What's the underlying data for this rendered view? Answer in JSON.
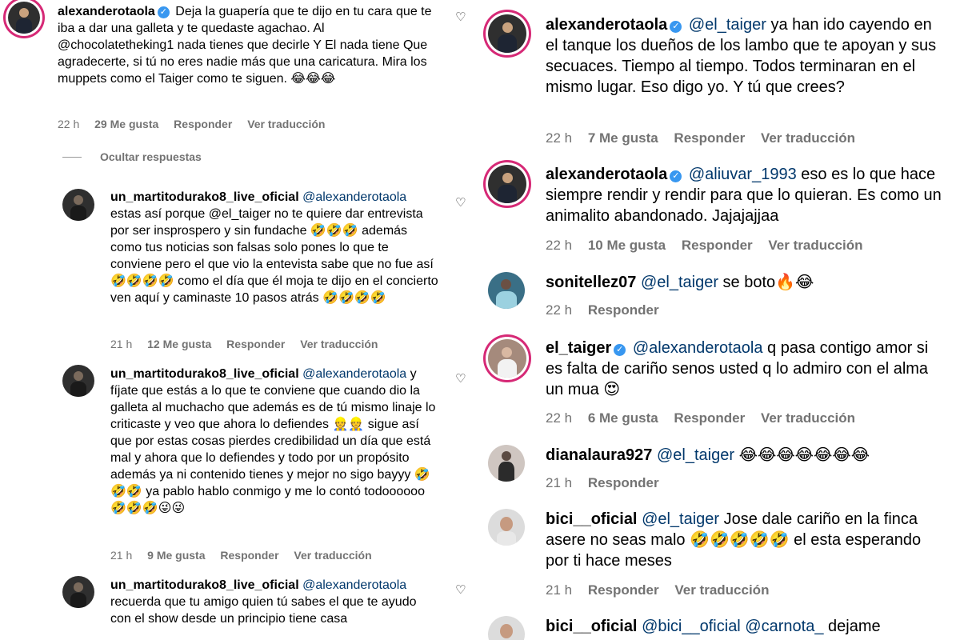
{
  "left": {
    "comments": [
      {
        "username": "alexanderotaola",
        "verified": true,
        "mention": "",
        "text": "Deja la guapería que te dijo en tu cara que te iba a dar una galleta y te quedaste agachao. Al @chocolatetheking1 nada tienes que decirle Y El nada tiene Que agradecerte, si tú no eres nadie más que una caricatura. Mira los muppets como el Taiger como te siguen. 😂😂😂",
        "time": "22 h",
        "likes": "29 Me gusta",
        "reply": "Responder",
        "translate": "Ver traducción"
      },
      {
        "username": "un_martitodurako8_live_oficial",
        "verified": false,
        "mention": "@alexanderotaola",
        "text": "estas así porque @el_taiger no te quiere dar entrevista por ser insprospero y sin fundache 🤣🤣🤣 además como tus noticias son falsas solo pones lo que te conviene pero el que vio la entevista sabe que no fue así 🤣🤣🤣🤣 como el día que él moja te dijo en el concierto ven aquí y caminaste 10 pasos atrás 🤣🤣🤣🤣",
        "time": "21 h",
        "likes": "12 Me gusta",
        "reply": "Responder",
        "translate": "Ver traducción"
      },
      {
        "username": "un_martitodurako8_live_oficial",
        "verified": false,
        "mention": "@alexanderotaola",
        "text": "y fíjate que estás a lo que te conviene que cuando dio la galleta al muchacho que además es de tú mismo linaje lo criticaste y veo que ahora lo defiendes 👷👷 sigue así que por estas cosas pierdes credibilidad un día que está mal y ahora que lo defiendes y todo por un propósito además ya ni contenido tienes y mejor no sigo bayyy 🤣🤣🤣 ya pablo hablo conmigo y me lo contó todoooooo 🤣🤣🤣😜😜",
        "time": "21 h",
        "likes": "9 Me gusta",
        "reply": "Responder",
        "translate": "Ver traducción"
      },
      {
        "username": "un_martitodurako8_live_oficial",
        "verified": false,
        "mention": "@alexanderotaola",
        "text": "recuerda que tu amigo quien tú sabes el que te ayudo con el show desde un principio tiene casa"
      }
    ],
    "hide_replies": "Ocultar respuestas"
  },
  "right": {
    "comments": [
      {
        "username": "alexanderotaola",
        "verified": true,
        "mention": "@el_taiger",
        "text": "ya han ido cayendo en el tanque los dueños de los lambo que te apoyan y sus secuaces. Tiempo al tiempo. Todos terminaran en el mismo lugar. Eso digo yo. Y tú que crees?",
        "time": "22 h",
        "likes": "7 Me gusta",
        "reply": "Responder",
        "translate": "Ver traducción"
      },
      {
        "username": "alexanderotaola",
        "verified": true,
        "mention": "@aliuvar_1993",
        "text": "eso es lo que hace siempre rendir y rendir para que lo quieran. Es como un animalito abandonado. Jajajajjaa",
        "time": "22 h",
        "likes": "10 Me gusta",
        "reply": "Responder",
        "translate": "Ver traducción"
      },
      {
        "username": "sonitellez07",
        "verified": false,
        "mention": "@el_taiger",
        "text": "se boto🔥😂",
        "time": "22 h",
        "reply": "Responder"
      },
      {
        "username": "el_taiger",
        "verified": true,
        "mention": "@alexanderotaola",
        "text": "q pasa contigo amor si es falta de cariño senos usted q lo admiro con el alma un mua 😍",
        "time": "22 h",
        "likes": "6 Me gusta",
        "reply": "Responder",
        "translate": "Ver traducción"
      },
      {
        "username": "dianalaura927",
        "verified": false,
        "mention": "@el_taiger",
        "text": "😂😂😂😂😂😂😂",
        "time": "21 h",
        "reply": "Responder"
      },
      {
        "username": "bici__oficial",
        "verified": false,
        "mention": "@el_taiger",
        "text": "Jose dale cariño en la finca asere no seas malo 🤣🤣🤣🤣🤣 el esta esperando por ti hace meses",
        "time": "21 h",
        "reply": "Responder",
        "translate": "Ver traducción"
      },
      {
        "username": "bici__oficial",
        "verified": false,
        "mention": "@bici__oficial @carnota_",
        "text": "dejame"
      }
    ]
  },
  "icons": {
    "like": "heart-outline-icon",
    "verified": "verified-badge-icon"
  },
  "colors": {
    "mention": "#00376b",
    "meta": "#737373",
    "verified": "#3897f0",
    "story_ring": "#d62976"
  }
}
